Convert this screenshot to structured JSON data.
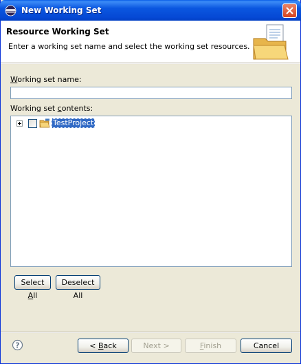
{
  "window": {
    "title": "New Working Set"
  },
  "header": {
    "title": "Resource Working Set",
    "description": "Enter a working set name and select the working set resources."
  },
  "form": {
    "name_label_mnemonic": "W",
    "name_label_rest": "orking set name:",
    "name_value": "",
    "contents_label_start": "Working set ",
    "contents_label_mnemonic": "c",
    "contents_label_rest": "ontents:"
  },
  "tree": {
    "items": [
      {
        "label": "TestProject",
        "checked": false,
        "expanded": false,
        "selected": true
      }
    ]
  },
  "buttons": {
    "select_all_start": "Select ",
    "select_all_mnemonic": "A",
    "select_all_rest": "ll",
    "deselect_all": "Deselect All",
    "back_start": "< ",
    "back_mnemonic": "B",
    "back_rest": "ack",
    "next": "Next >",
    "finish_mnemonic": "F",
    "finish_rest": "inish",
    "cancel": "Cancel"
  },
  "colors": {
    "title_bar": "#0549d3",
    "selection": "#316ac5",
    "dialog_bg": "#ece9d8"
  }
}
